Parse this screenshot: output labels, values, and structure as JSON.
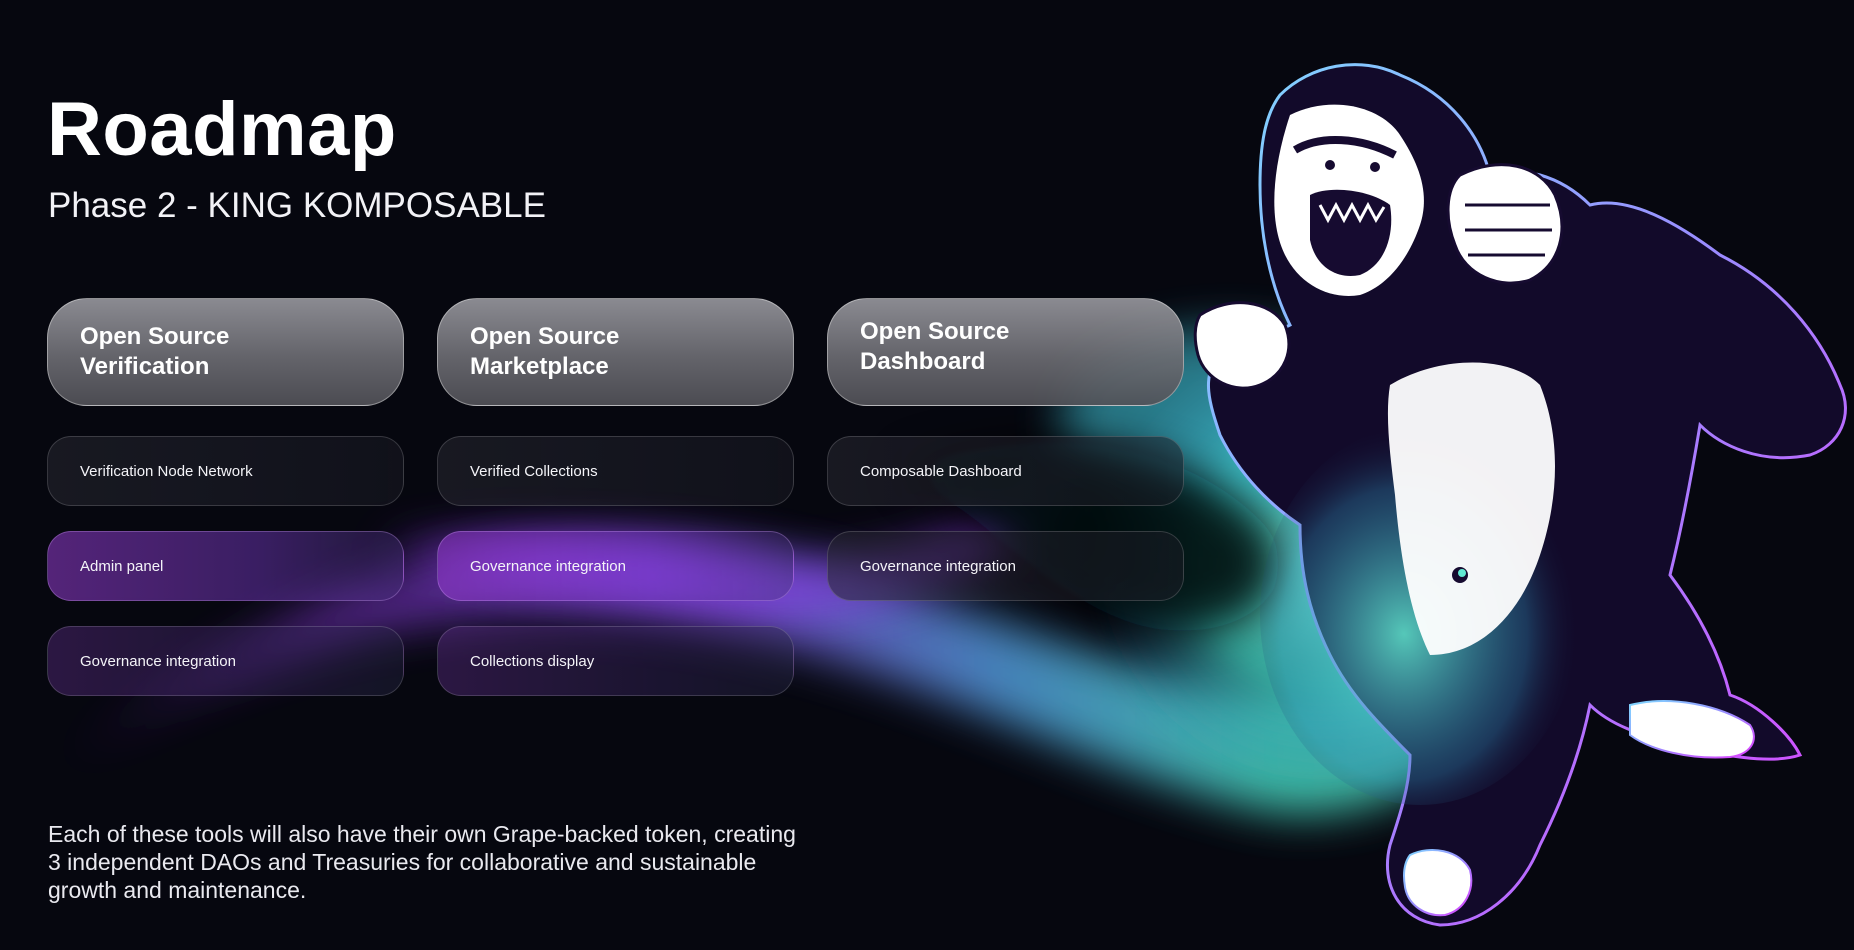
{
  "page": {
    "title": "Roadmap",
    "subtitle": "Phase 2 - KING KOMPOSABLE",
    "footer": "Each of these tools will also have their own Grape-backed token, creating 3 independent DAOs and Treasuries for collaborative and sustainable growth and maintenance."
  },
  "columns": [
    {
      "heading": "Open Source\nVerification",
      "items": [
        "Verification Node Network",
        "Admin panel",
        "Governance integration"
      ]
    },
    {
      "heading": "Open Source\nMarketplace",
      "items": [
        "Verified Collections",
        "Governance integration",
        "Collections display"
      ]
    },
    {
      "heading": "Open Source\nDashboard",
      "items": [
        "Composable Dashboard",
        "Governance integration"
      ]
    }
  ],
  "illustration": {
    "subject": "gorilla-icon",
    "colors": {
      "outline_cyan": "#7fd8ff",
      "outline_magenta": "#e040ff",
      "glow_teal": "#4fe6c8",
      "glow_purple": "#9b3bff",
      "background": "#06070f"
    }
  }
}
